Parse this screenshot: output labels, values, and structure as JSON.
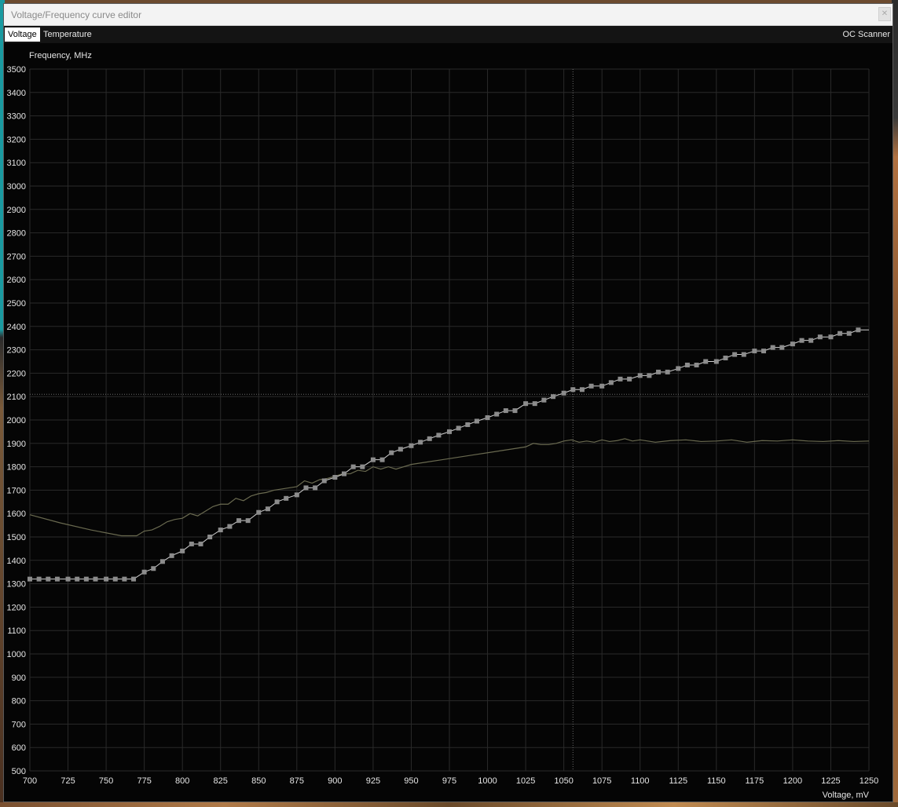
{
  "window": {
    "title": "Voltage/Frequency curve editor",
    "close_icon": "close-icon"
  },
  "tabs": [
    {
      "label": "Voltage",
      "active": true
    },
    {
      "label": "Temperature",
      "active": false
    }
  ],
  "oc_scanner_label": "OC Scanner",
  "colors": {
    "background": "#050505",
    "grid": "#2a2a2a",
    "curve": "#cfcfcf",
    "points": "#8c8c8c",
    "secondary_curve": "#6a6a50",
    "text": "#e6e6e6"
  },
  "chart_data": {
    "type": "line",
    "ylabel": "Frequency, MHz",
    "xlabel": "Voltage, mV",
    "xlim": [
      700,
      1250
    ],
    "ylim": [
      500,
      3500
    ],
    "x_ticks": [
      700,
      725,
      750,
      775,
      800,
      825,
      850,
      875,
      900,
      925,
      950,
      975,
      1000,
      1025,
      1050,
      1075,
      1100,
      1125,
      1150,
      1175,
      1200,
      1225,
      1250
    ],
    "y_ticks": [
      500,
      600,
      700,
      800,
      900,
      1000,
      1100,
      1200,
      1300,
      1400,
      1500,
      1600,
      1700,
      1800,
      1900,
      2000,
      2100,
      2200,
      2300,
      2400,
      2500,
      2600,
      2700,
      2800,
      2900,
      3000,
      3100,
      3200,
      3300,
      3400,
      3500
    ],
    "grid": true,
    "crosshair": {
      "voltage": 1056,
      "frequency": 2110
    },
    "series": [
      {
        "style": "points",
        "x": [
          700,
          706,
          712,
          718,
          725,
          731,
          737,
          743,
          750,
          756,
          762,
          768,
          775,
          781,
          787,
          793,
          800,
          806,
          812,
          818,
          825,
          831,
          837,
          843,
          850,
          856,
          862,
          868,
          875,
          881,
          887,
          893,
          900,
          906,
          912,
          918,
          925,
          931,
          937,
          943,
          950,
          956,
          962,
          968,
          975,
          981,
          987,
          993,
          1000,
          1006,
          1012,
          1018,
          1025,
          1031,
          1037,
          1043,
          1050,
          1056,
          1062,
          1068,
          1075,
          1081,
          1087,
          1093,
          1100,
          1106,
          1112,
          1118,
          1125,
          1131,
          1137,
          1143,
          1150,
          1156,
          1162,
          1168,
          1175,
          1181,
          1187,
          1193,
          1200,
          1206,
          1212,
          1218,
          1225,
          1231,
          1237,
          1243
        ],
        "y": [
          1320,
          1320,
          1320,
          1320,
          1320,
          1320,
          1320,
          1320,
          1320,
          1320,
          1320,
          1320,
          1350,
          1365,
          1395,
          1420,
          1440,
          1470,
          1470,
          1500,
          1530,
          1545,
          1570,
          1570,
          1605,
          1620,
          1650,
          1665,
          1680,
          1710,
          1710,
          1740,
          1755,
          1770,
          1800,
          1800,
          1830,
          1830,
          1860,
          1875,
          1890,
          1905,
          1920,
          1935,
          1950,
          1965,
          1980,
          1995,
          2010,
          2025,
          2040,
          2040,
          2070,
          2070,
          2085,
          2100,
          2115,
          2130,
          2130,
          2145,
          2145,
          2160,
          2175,
          2175,
          2190,
          2190,
          2205,
          2205,
          2220,
          2235,
          2235,
          2250,
          2250,
          2265,
          2280,
          2280,
          2295,
          2295,
          2310,
          2310,
          2325,
          2340,
          2340,
          2355,
          2355,
          2370,
          2370,
          2385
        ]
      },
      {
        "style": "line",
        "x": [
          700,
          720,
          740,
          760,
          770,
          775,
          780,
          785,
          790,
          795,
          800,
          805,
          810,
          815,
          820,
          825,
          830,
          835,
          840,
          845,
          850,
          855,
          860,
          865,
          870,
          875,
          880,
          885,
          890,
          895,
          900,
          905,
          910,
          915,
          920,
          925,
          930,
          935,
          940,
          950,
          960,
          970,
          980,
          990,
          1000,
          1010,
          1015,
          1020,
          1025,
          1030,
          1035,
          1040,
          1045,
          1050,
          1055,
          1060,
          1065,
          1070,
          1075,
          1080,
          1085,
          1090,
          1095,
          1100,
          1110,
          1120,
          1130,
          1140,
          1150,
          1160,
          1170,
          1180,
          1190,
          1200,
          1210,
          1220,
          1230,
          1240,
          1250
        ],
        "y": [
          1595,
          1560,
          1530,
          1505,
          1505,
          1525,
          1530,
          1545,
          1565,
          1575,
          1580,
          1600,
          1590,
          1610,
          1630,
          1640,
          1640,
          1665,
          1655,
          1675,
          1685,
          1690,
          1700,
          1705,
          1710,
          1715,
          1740,
          1730,
          1745,
          1750,
          1760,
          1770,
          1770,
          1785,
          1780,
          1800,
          1790,
          1800,
          1790,
          1810,
          1820,
          1830,
          1840,
          1850,
          1860,
          1870,
          1875,
          1880,
          1885,
          1900,
          1895,
          1895,
          1900,
          1910,
          1915,
          1905,
          1910,
          1905,
          1915,
          1908,
          1912,
          1920,
          1910,
          1915,
          1905,
          1912,
          1915,
          1908,
          1910,
          1915,
          1905,
          1912,
          1910,
          1915,
          1910,
          1908,
          1912,
          1908,
          1910
        ]
      }
    ]
  }
}
